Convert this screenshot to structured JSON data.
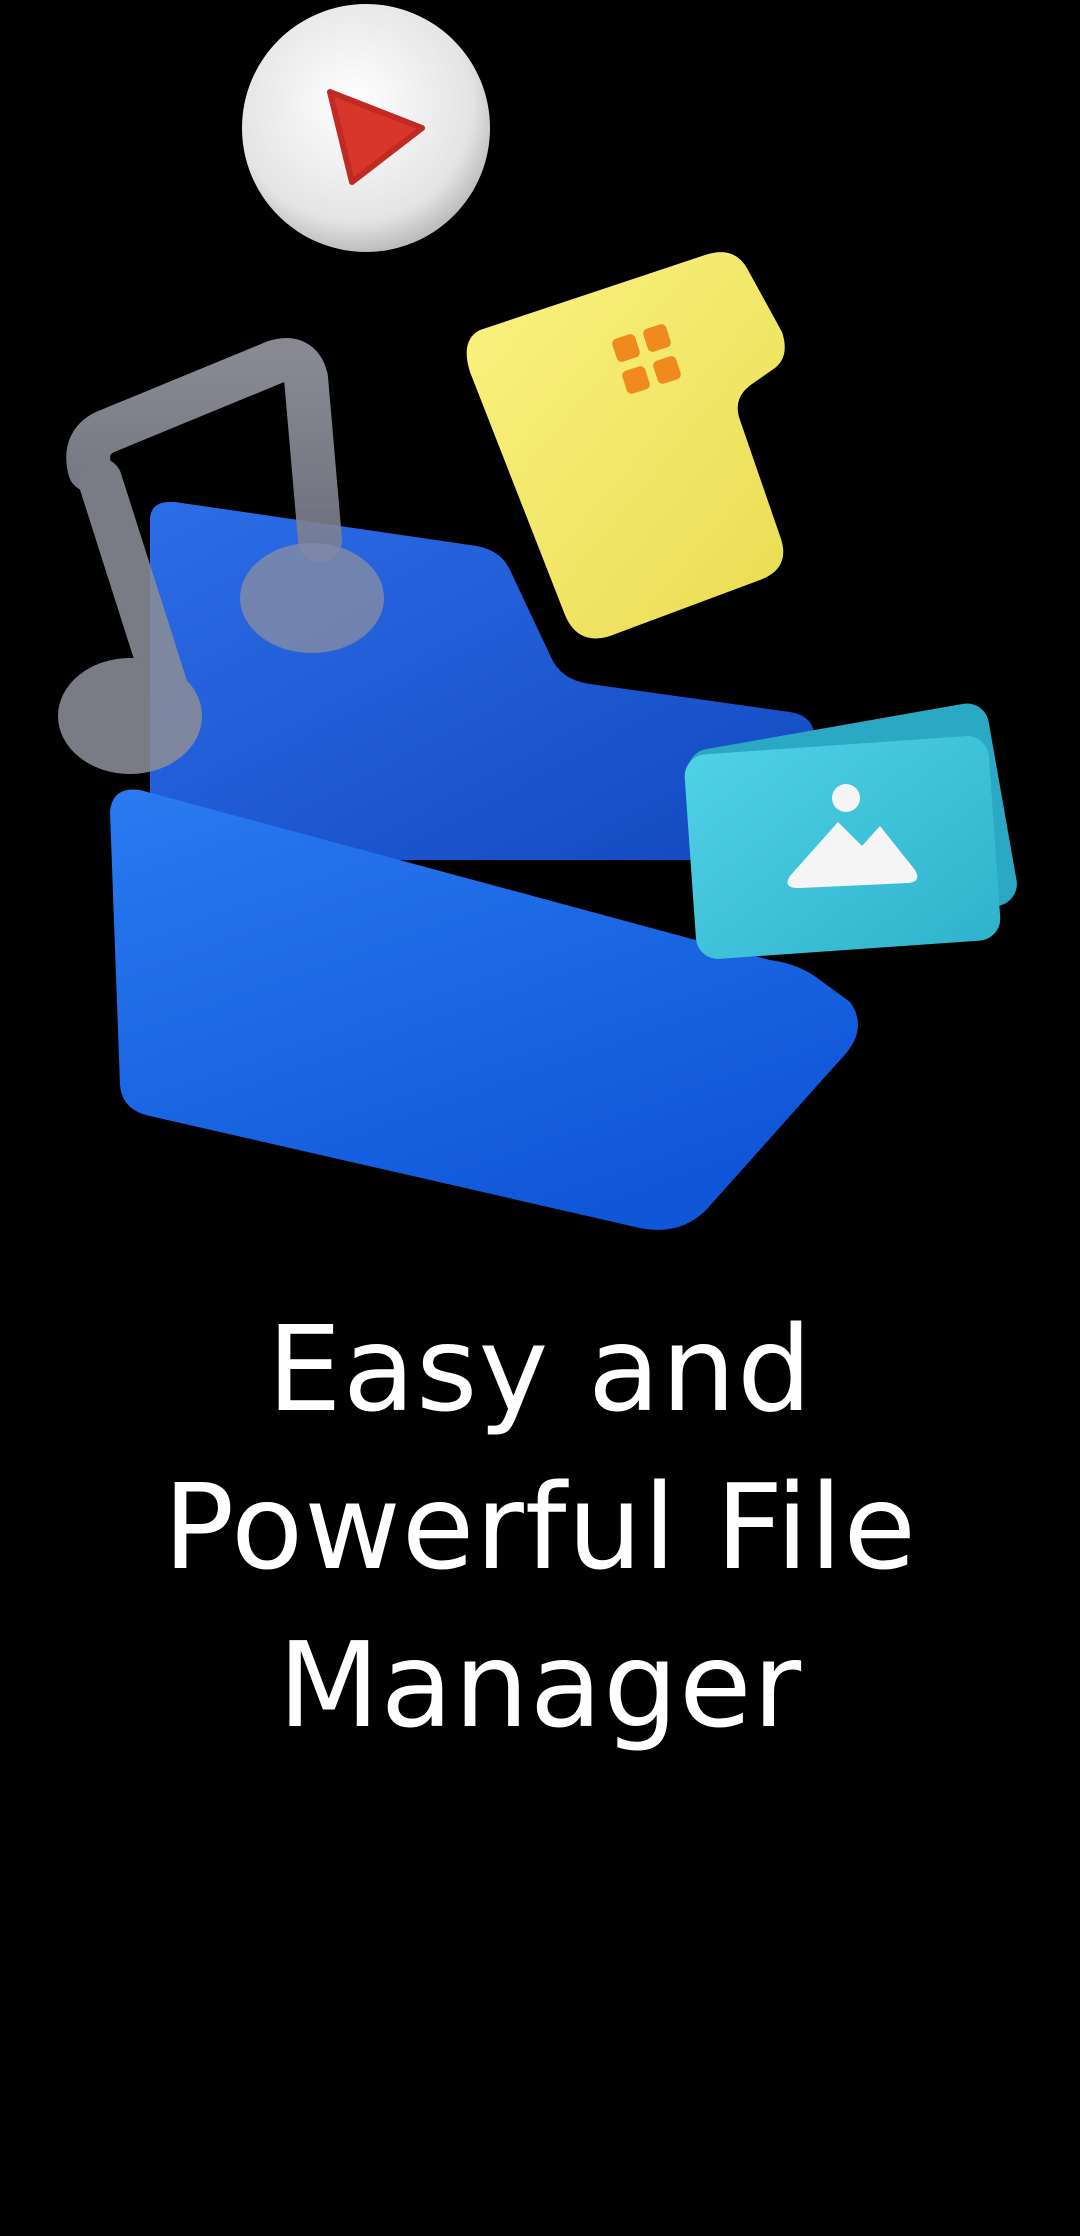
{
  "onboarding": {
    "title_lines": [
      "Easy and",
      "Powerful File",
      "Manager"
    ]
  },
  "illustration": {
    "icons": [
      "play-icon",
      "music-note-icon",
      "app-grid-icon",
      "folder-icon",
      "image-icon"
    ],
    "colors": {
      "background": "#000000",
      "folder": "#1565e0",
      "folder_back": "#1e5bd6",
      "play_circle": "#f2f2f2",
      "play_triangle": "#d9362b",
      "music_note": "#8d8f99",
      "yellow_card": "#f2ea6a",
      "grid_squares": "#f08a1e",
      "photo_card": "#39c2d8",
      "photo_glyph": "#f5f5f5"
    }
  }
}
